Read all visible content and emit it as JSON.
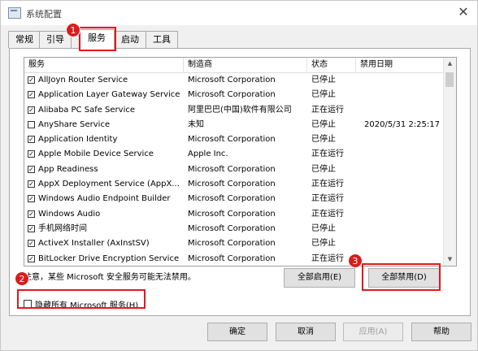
{
  "window": {
    "title": "系统配置",
    "close_glyph": "✕"
  },
  "tabs": [
    {
      "label": "常规"
    },
    {
      "label": "引导"
    },
    {
      "label": "服务"
    },
    {
      "label": "启动"
    },
    {
      "label": "工具"
    }
  ],
  "columns": [
    "服务",
    "制造商",
    "状态",
    "禁用日期"
  ],
  "services": [
    {
      "checked": true,
      "name": "AllJoyn Router Service",
      "vendor": "Microsoft Corporation",
      "status": "已停止",
      "date": ""
    },
    {
      "checked": true,
      "name": "Application Layer Gateway Service",
      "vendor": "Microsoft Corporation",
      "status": "已停止",
      "date": ""
    },
    {
      "checked": true,
      "name": "Alibaba PC Safe Service",
      "vendor": "阿里巴巴(中国)软件有限公司",
      "status": "正在运行",
      "date": ""
    },
    {
      "checked": false,
      "name": "AnyShare Service",
      "vendor": "未知",
      "status": "已停止",
      "date": "2020/5/31 2:25:17"
    },
    {
      "checked": true,
      "name": "Application Identity",
      "vendor": "Microsoft Corporation",
      "status": "已停止",
      "date": ""
    },
    {
      "checked": true,
      "name": "Apple Mobile Device Service",
      "vendor": "Apple Inc.",
      "status": "正在运行",
      "date": ""
    },
    {
      "checked": true,
      "name": "App Readiness",
      "vendor": "Microsoft Corporation",
      "status": "已停止",
      "date": ""
    },
    {
      "checked": true,
      "name": "AppX Deployment Service (AppX...",
      "vendor": "Microsoft Corporation",
      "status": "正在运行",
      "date": ""
    },
    {
      "checked": true,
      "name": "Windows Audio Endpoint Builder",
      "vendor": "Microsoft Corporation",
      "status": "正在运行",
      "date": ""
    },
    {
      "checked": true,
      "name": "Windows Audio",
      "vendor": "Microsoft Corporation",
      "status": "正在运行",
      "date": ""
    },
    {
      "checked": true,
      "name": "手机网络时间",
      "vendor": "Microsoft Corporation",
      "status": "已停止",
      "date": ""
    },
    {
      "checked": true,
      "name": "ActiveX Installer (AxInstSV)",
      "vendor": "Microsoft Corporation",
      "status": "已停止",
      "date": ""
    },
    {
      "checked": true,
      "name": "BitLocker Drive Encryption Service",
      "vendor": "Microsoft Corporation",
      "status": "正在运行",
      "date": ""
    }
  ],
  "note": "注意，某些 Microsoft 安全服务可能无法禁用。",
  "buttons": {
    "enable_all": "全部启用(E)",
    "disable_all": "全部禁用(D)",
    "hide_ms": "隐藏所有 Microsoft 服务(H)",
    "ok": "确定",
    "cancel": "取消",
    "apply": "应用(A)",
    "help": "帮助"
  },
  "annotations": [
    "1",
    "2",
    "3"
  ],
  "colors": {
    "highlight": "#e0191b",
    "badge": "#d91d1d"
  }
}
